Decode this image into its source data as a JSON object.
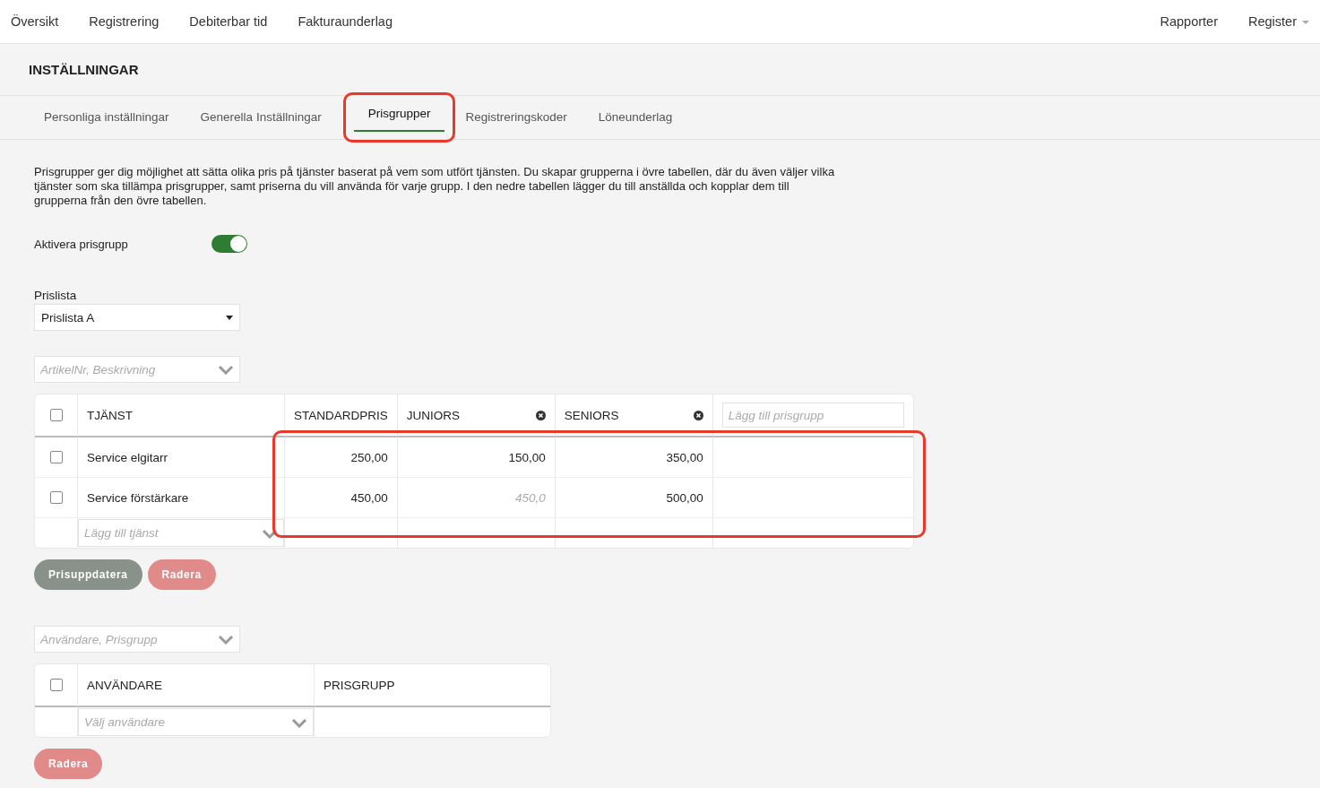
{
  "nav": {
    "items": [
      {
        "label": "Översikt"
      },
      {
        "label": "Registrering"
      },
      {
        "label": "Debiterbar tid"
      },
      {
        "label": "Fakturaunderlag"
      }
    ],
    "right_items": [
      {
        "label": "Rapporter",
        "dropdown": false
      },
      {
        "label": "Register",
        "dropdown": true
      }
    ]
  },
  "page_title": "INSTÄLLNINGAR",
  "tabs": [
    {
      "label": "Personliga inställningar",
      "selected": false
    },
    {
      "label": "Generella Inställningar",
      "selected": false
    },
    {
      "label": "Prisgrupper",
      "selected": true
    },
    {
      "label": "Registreringskoder",
      "selected": false
    },
    {
      "label": "Löneunderlag",
      "selected": false
    }
  ],
  "description": "Prisgrupper ger dig möjlighet att sätta olika pris på tjänster baserat på vem som utfört tjänsten. Du skapar grupperna i övre tabellen, där du även väljer vilka tjänster som ska tillämpa prisgrupper, samt priserna du vill använda för varje grupp. I den nedre tabellen lägger du till anställda och kopplar dem till grupperna från den övre tabellen.",
  "toggle": {
    "label": "Aktivera prisgrupp",
    "on": true
  },
  "price_list": {
    "label": "Prislista",
    "value": "Prislista A"
  },
  "service_search": {
    "placeholder": "ArtikelNr, Beskrivning"
  },
  "services_table": {
    "header_checked": false,
    "columns": [
      {
        "label": "TJÄNST",
        "removable": false
      },
      {
        "label": "STANDARDPRIS",
        "removable": false
      },
      {
        "label": "JUNIORS",
        "removable": true
      },
      {
        "label": "SENIORS",
        "removable": true
      }
    ],
    "add_group_placeholder": "Lägg till prisgrupp",
    "rows": [
      {
        "checked": false,
        "name": "Service elgitarr",
        "prices": [
          {
            "text": "250,00",
            "kind": "value"
          },
          {
            "text": "150,00",
            "kind": "value"
          },
          {
            "text": "350,00",
            "kind": "value"
          }
        ]
      },
      {
        "checked": false,
        "name": "Service förstärkare",
        "prices": [
          {
            "text": "450,00",
            "kind": "value"
          },
          {
            "placeholder": "450,0",
            "kind": "input"
          },
          {
            "text": "500,00",
            "kind": "value"
          }
        ]
      }
    ],
    "add_service_placeholder": "Lägg till tjänst"
  },
  "service_buttons": [
    {
      "label": "Prisuppdatera",
      "kind": "neutral",
      "disabled": true
    },
    {
      "label": "Radera",
      "kind": "danger",
      "disabled": true
    }
  ],
  "user_search": {
    "placeholder": "Användare, Prisgrupp"
  },
  "users_table": {
    "header_checked": false,
    "columns": [
      {
        "label": "ANVÄNDARE"
      },
      {
        "label": "PRISGRUPP"
      }
    ],
    "add_user_placeholder": "Välj användare"
  },
  "user_buttons": [
    {
      "label": "Radera",
      "kind": "danger",
      "disabled": true
    }
  ]
}
